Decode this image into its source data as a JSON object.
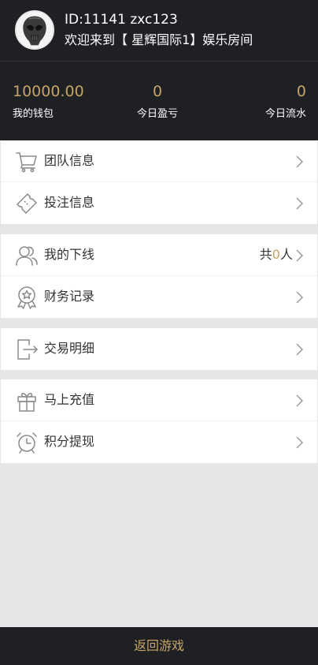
{
  "user": {
    "id_line": "ID:11141 zxc123",
    "welcome": "欢迎来到【 星辉国际1】娱乐房间",
    "avatar_icon": "alien-helmet-avatar"
  },
  "stats": {
    "wallet": {
      "value": "10000.00",
      "label": "我的钱包"
    },
    "profit": {
      "value": "0",
      "label": "今日盈亏"
    },
    "flow": {
      "value": "0",
      "label": "今日流水"
    }
  },
  "menu": {
    "team": {
      "label": "团队信息",
      "icon": "cart-icon"
    },
    "bet": {
      "label": "投注信息",
      "icon": "ticket-icon"
    },
    "downline": {
      "label": "我的下线",
      "icon": "users-icon",
      "count_prefix": "共",
      "count": "0",
      "count_suffix": "人"
    },
    "finance": {
      "label": "财务记录",
      "icon": "medal-icon"
    },
    "transaction": {
      "label": "交易明细",
      "icon": "exit-icon"
    },
    "recharge": {
      "label": "马上充值",
      "icon": "gift-icon"
    },
    "withdraw": {
      "label": "积分提现",
      "icon": "alarm-clock-icon"
    }
  },
  "bottom": {
    "label": "返回游戏"
  },
  "colors": {
    "accent": "#c6a467",
    "header_bg": "#1f2024",
    "icon_gray": "#8a8a8a"
  }
}
